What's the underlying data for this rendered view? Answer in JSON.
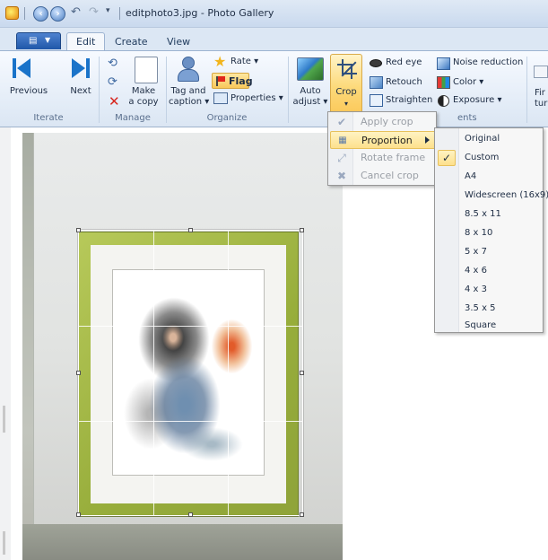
{
  "window": {
    "title": "editphoto3.jpg - Photo Gallery"
  },
  "quick_access": {
    "undo_glyph": "↶",
    "redo_glyph": "↷",
    "customize_glyph": "▾"
  },
  "ribbon_tabs": [
    {
      "label": "Edit",
      "active": true
    },
    {
      "label": "Create",
      "active": false
    },
    {
      "label": "View",
      "active": false
    }
  ],
  "groups": {
    "iterate": {
      "label": "Iterate",
      "previous": "Previous",
      "next": "Next"
    },
    "manage": {
      "label": "Manage",
      "make_copy": [
        "Make",
        "a copy"
      ]
    },
    "organize": {
      "label": "Organize",
      "tag_caption": [
        "Tag and",
        "caption ▾"
      ],
      "rate": "Rate ▾",
      "flag": "Flag",
      "properties": "Properties ▾"
    },
    "adjustments": {
      "label": "ents",
      "auto_adjust": [
        "Auto",
        "adjust ▾"
      ],
      "crop": "Crop",
      "crop_caret": "▾",
      "red_eye": "Red eye",
      "retouch": "Retouch",
      "straighten": "Straighten",
      "noise_reduction": "Noise reduction",
      "color": "Color ▾",
      "exposure": "Exposure ▾"
    },
    "fine_tune": {
      "label_partial": [
        "Fir",
        "tur"
      ]
    }
  },
  "crop_menu": {
    "items": [
      {
        "label": "Apply crop",
        "enabled": false,
        "icon": "check-icon"
      },
      {
        "label": "Proportion",
        "enabled": true,
        "highlighted": true,
        "icon": "proportion-icon",
        "has_submenu": true
      },
      {
        "label": "Rotate frame",
        "enabled": false,
        "icon": "rotate-frame-icon"
      },
      {
        "label": "Cancel crop",
        "enabled": false,
        "icon": "cancel-crop-icon"
      }
    ]
  },
  "proportion_submenu": {
    "selected": "Custom",
    "check_glyph": "✓",
    "items": [
      "Original",
      "Custom",
      "A4",
      "Widescreen (16x9)",
      "8.5 x 11",
      "8 x 10",
      "5 x 7",
      "4 x 6",
      "4 x 3",
      "3.5 x 5",
      "Square"
    ]
  },
  "colors": {
    "accent_blue": "#1a73c9",
    "highlight_yellow": "#fde08c",
    "frame_green": "#a2b844"
  }
}
